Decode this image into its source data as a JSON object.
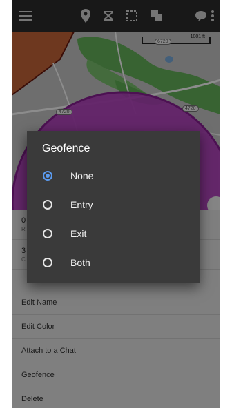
{
  "toolbar": {
    "icons": [
      "menu-icon",
      "map-pin-icon",
      "route-icon",
      "select-area-icon",
      "layers-icon",
      "chat-icon",
      "more-icon"
    ]
  },
  "map": {
    "scale_label": "1001 ft",
    "road_badges": [
      "6720",
      "4720",
      "4720"
    ]
  },
  "dialog": {
    "title": "Geofence",
    "options": [
      {
        "label": "None",
        "selected": true
      },
      {
        "label": "Entry",
        "selected": false
      },
      {
        "label": "Exit",
        "selected": false
      },
      {
        "label": "Both",
        "selected": false
      }
    ]
  },
  "list": {
    "info_rows": [
      {
        "title": "0",
        "subtitle": "R"
      },
      {
        "title": "3",
        "subtitle": "C"
      }
    ],
    "items": [
      "Edit Name",
      "Edit Color",
      "Attach to a Chat",
      "Geofence",
      "Delete"
    ]
  },
  "colors": {
    "geofence_fill": "#b43cc0",
    "radio_accent": "#5b9bf0",
    "park_green": "#62b356",
    "region_orange": "#c8663a"
  }
}
